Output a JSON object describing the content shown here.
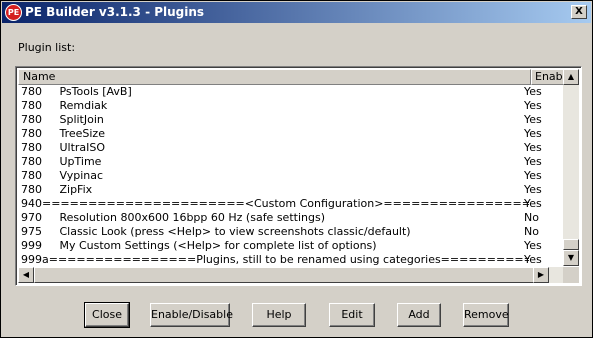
{
  "window": {
    "title": "PE Builder v3.1.3 - Plugins",
    "icon_text": "PE",
    "close_glyph": "X"
  },
  "plugin_list_label": "Plugin list:",
  "columns": {
    "name": "Name",
    "enabled": "Enabled"
  },
  "rows": [
    {
      "name": "780     PsTools [AvB]",
      "enabled": "Yes"
    },
    {
      "name": "780     Remdiak",
      "enabled": "Yes"
    },
    {
      "name": "780     SplitJoin",
      "enabled": "Yes"
    },
    {
      "name": "780     TreeSize",
      "enabled": "Yes"
    },
    {
      "name": "780     UltraISO",
      "enabled": "Yes"
    },
    {
      "name": "780     UpTime",
      "enabled": "Yes"
    },
    {
      "name": "780     Vypinac",
      "enabled": "Yes"
    },
    {
      "name": "780     ZipFix",
      "enabled": "Yes"
    },
    {
      "name": "940======================<Custom Configuration>==============================",
      "enabled": "Yes"
    },
    {
      "name": "970     Resolution 800x600 16bpp 60 Hz (safe settings)",
      "enabled": "No"
    },
    {
      "name": "975     Classic Look (press <Help> to view screenshots classic/default)",
      "enabled": "No"
    },
    {
      "name": "999     My Custom Settings (<Help> for complete list of options)",
      "enabled": "Yes"
    },
    {
      "name": "999a================Plugins, still to be renamed using categories===================...",
      "enabled": "Yes"
    }
  ],
  "buttons": {
    "close": "Close",
    "enable_disable": "Enable/Disable",
    "help": "Help",
    "edit": "Edit",
    "add": "Add",
    "remove": "Remove"
  },
  "scroll_glyphs": {
    "up": "▲",
    "down": "▼",
    "left": "◀",
    "right": "▶"
  }
}
